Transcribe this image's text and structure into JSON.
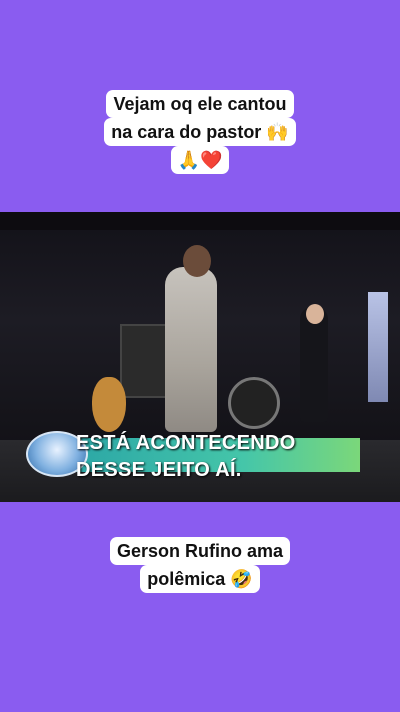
{
  "top_caption": {
    "line1": "Vejam oq ele cantou",
    "line2": "na cara do pastor 🙌",
    "line3": "🙏❤️"
  },
  "video": {
    "banner_line1": "ESTÁ ACONTECENDO",
    "banner_line2": "DESSE JEITO AÍ."
  },
  "bottom_caption": {
    "line1": "Gerson Rufino ama",
    "line2": "polêmica 🤣"
  },
  "colors": {
    "background": "#8a5cf0",
    "caption_box": "#ffffff",
    "banner": "#45c6a9"
  }
}
